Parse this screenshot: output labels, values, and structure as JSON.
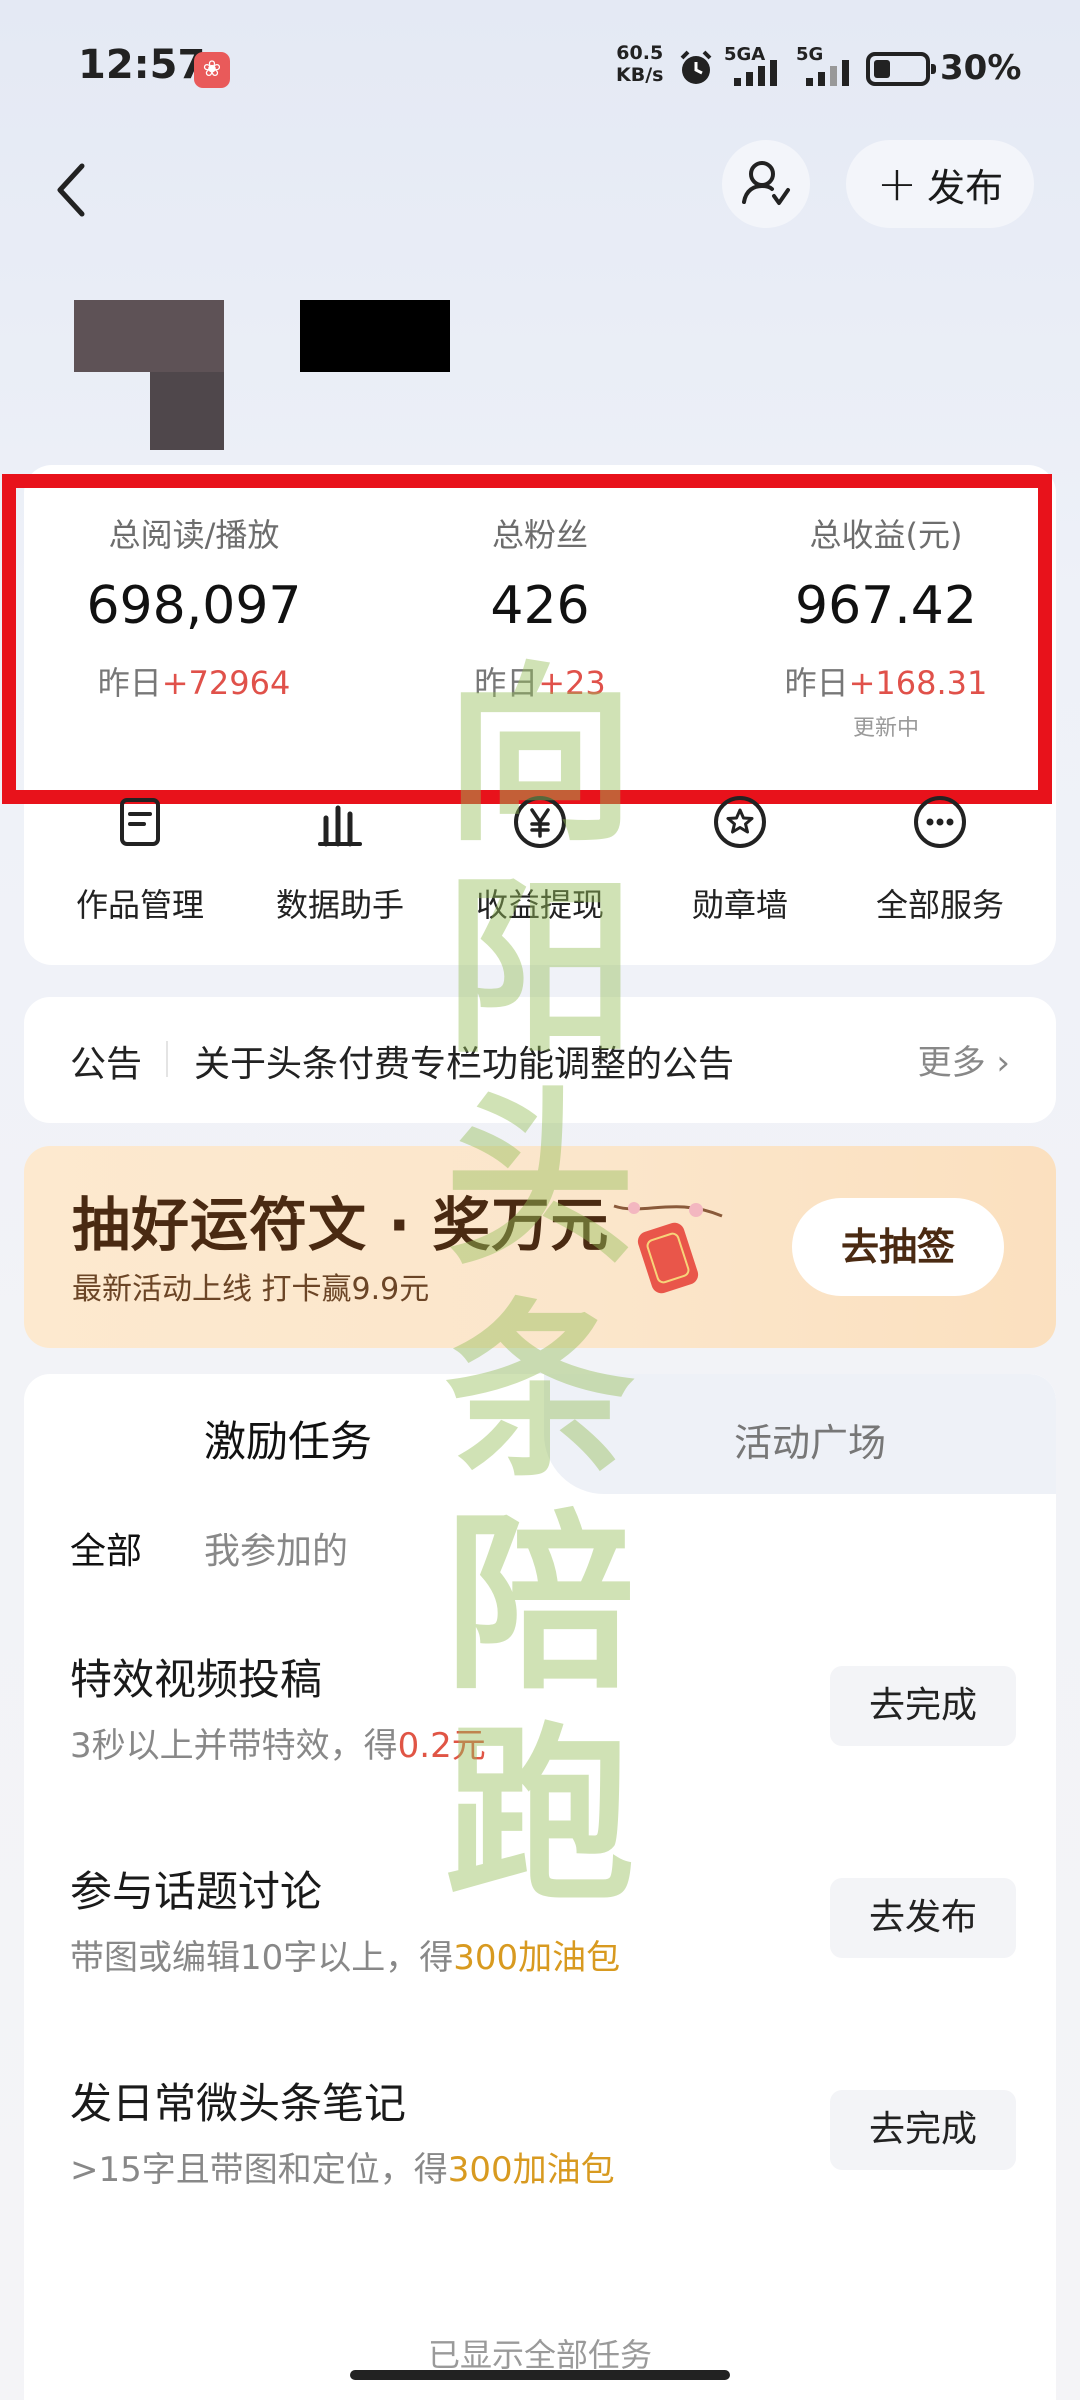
{
  "status_bar": {
    "time": "12:57",
    "app_badge": "",
    "net_speed_value": "60.5",
    "net_speed_unit": "KB/s",
    "sig1_label": "5GA",
    "sig2_label": "5G",
    "battery_percent": "30%",
    "battery_level": 0.3
  },
  "header": {
    "publish_label": "发布"
  },
  "stats": [
    {
      "label": "总阅读/播放",
      "value": "698,097",
      "delta_prefix": "昨日",
      "delta": "+72964",
      "sub": ""
    },
    {
      "label": "总粉丝",
      "value": "426",
      "delta_prefix": "昨日",
      "delta": "+23",
      "sub": ""
    },
    {
      "label": "总收益(元)",
      "value": "967.42",
      "delta_prefix": "昨日",
      "delta": "+168.31",
      "sub": "更新中"
    }
  ],
  "services": [
    {
      "label": "作品管理",
      "icon": "document-icon"
    },
    {
      "label": "数据助手",
      "icon": "bar-chart-icon"
    },
    {
      "label": "收益提现",
      "icon": "yen-icon"
    },
    {
      "label": "勋章墙",
      "icon": "medal-icon"
    },
    {
      "label": "全部服务",
      "icon": "more-icon"
    }
  ],
  "notice": {
    "tag": "公告",
    "text": "关于头条付费专栏功能调整的公告",
    "more": "更多"
  },
  "banner": {
    "title": "抽好运符文 · 奖万元",
    "subtitle": "最新活动上线 打卡赢9.9元",
    "button": "去抽签"
  },
  "tasks": {
    "tabs": [
      "激励任务",
      "活动广场"
    ],
    "filters": [
      "全部",
      "我参加的"
    ],
    "items": [
      {
        "title": "特效视频投稿",
        "desc": "3秒以上并带特效，得",
        "reward": "0.2元",
        "button": "去完成"
      },
      {
        "title": "参与话题讨论",
        "desc": "带图或编辑10字以上，得",
        "reward": "300加油包",
        "button": "去发布"
      },
      {
        "title": "发日常微头条笔记",
        "desc": ">15字且带图和定位，得",
        "reward": "300加油包",
        "button": "去完成"
      }
    ],
    "footer": "已显示全部任务"
  },
  "watermark": [
    "向",
    "阳",
    "头",
    "条",
    "陪",
    "跑"
  ],
  "colors": {
    "highlight_frame": "#e8121b",
    "delta_up": "#e0514a",
    "reward_gold": "#d89a20",
    "reward_red": "#e05545"
  }
}
